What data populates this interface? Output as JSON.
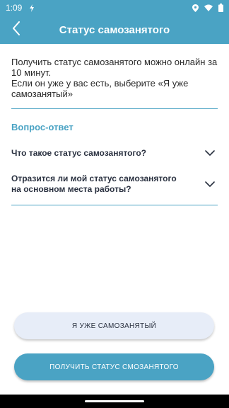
{
  "status_bar": {
    "time": "1:09"
  },
  "app_bar": {
    "title": "Статус самозанятого"
  },
  "intro": {
    "line1": "Получить статус самозанятого можно онлайн за",
    "line2": "10 минут.",
    "line3": "Если он уже у вас есть, выберите «Я уже",
    "line4": "самозанятый»"
  },
  "faq": {
    "heading": "Вопрос-ответ",
    "items": [
      {
        "question_line1": "Что такое статус самозанятого?"
      },
      {
        "question_line1": "Отразится ли мой статус самозанятого",
        "question_line2": "на основном места работы?"
      }
    ]
  },
  "buttons": {
    "already_self_employed": "Я УЖЕ САМОЗАНЯТЫЙ",
    "get_status": "ПОЛУЧИТЬ СТАТУС СМОЗАНЯТОГО"
  },
  "colors": {
    "accent": "#4aa3c4",
    "secondary_button": "#e7edf8",
    "text_dark": "#2a3140"
  },
  "icons": [
    "back-arrow-icon",
    "flash-icon",
    "location-icon",
    "wifi-icon",
    "battery-icon",
    "chevron-down-icon"
  ]
}
